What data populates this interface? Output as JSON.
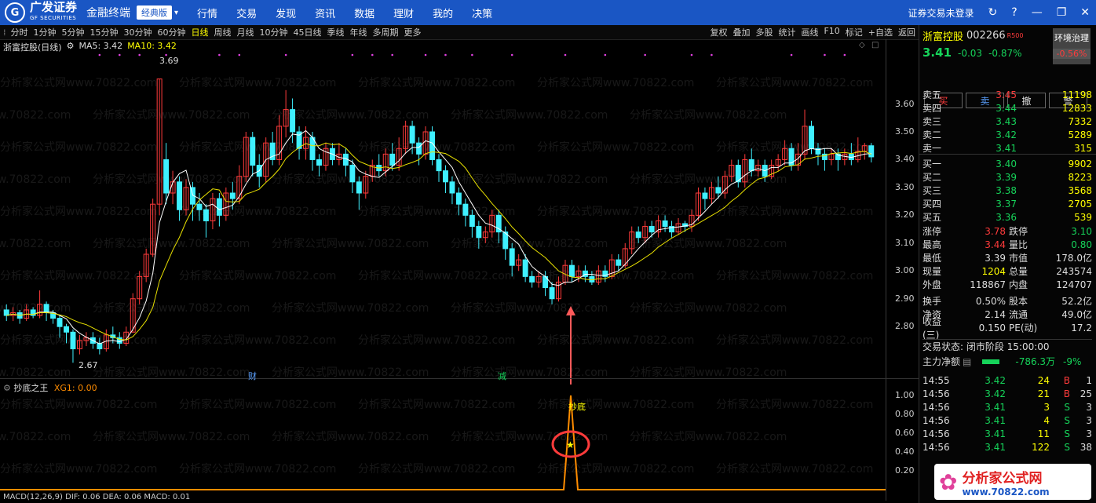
{
  "app": {
    "brand": "广发证券",
    "brand_sub": "GF SECURITIES",
    "app_name": "金融终端",
    "edition": "经典版",
    "menu": [
      "行情",
      "交易",
      "发现",
      "资讯",
      "数据",
      "理财",
      "我的",
      "决策"
    ],
    "login_status": "证券交易未登录"
  },
  "toolbar": {
    "periods": [
      "分时",
      "1分钟",
      "5分钟",
      "15分钟",
      "30分钟",
      "60分钟",
      "日线",
      "周线",
      "月线",
      "10分钟",
      "45日线",
      "季线",
      "年线",
      "多周期",
      "更多"
    ],
    "active_period": "日线",
    "right_tools": [
      "复权",
      "叠加",
      "多股",
      "统计",
      "画线",
      "F10",
      "标记",
      "+自选",
      "返回"
    ]
  },
  "chart_info": {
    "name": "浙富控股(日线)",
    "ma5": "MA5: 3.42",
    "ma10": "MA10: 3.42"
  },
  "price_axis": [
    "3.60",
    "3.50",
    "3.40",
    "3.30",
    "3.20",
    "3.10",
    "3.00",
    "2.90",
    "2.80"
  ],
  "annotations": {
    "high_label": "3.69",
    "low_label": "2.67",
    "cai": "财",
    "jian": "减",
    "chaodi": "抄底"
  },
  "indicator": {
    "name": "抄底之王",
    "xg": "XG1: 0.00",
    "axis": [
      "1.00",
      "0.80",
      "0.60",
      "0.40",
      "0.20"
    ],
    "macd_label": "MACD(12,26,9) DIF: 0.06 DEA: 0.06 MACD: 0.01"
  },
  "watermark": "分析家公式网www.70822.com",
  "stock": {
    "name": "浙富控股",
    "code": "002266",
    "tag": "R500",
    "env": "环境治理",
    "price": "3.41",
    "change": "-0.03",
    "change_pct": "-0.87%",
    "env_pct": "-0.56%",
    "buttons": [
      "买",
      "卖",
      "撤",
      "警"
    ]
  },
  "asks": [
    {
      "label": "卖五",
      "price": "3.45",
      "vol": "11198"
    },
    {
      "label": "卖四",
      "price": "3.44",
      "vol": "12833"
    },
    {
      "label": "卖三",
      "price": "3.43",
      "vol": "7332"
    },
    {
      "label": "卖二",
      "price": "3.42",
      "vol": "5289"
    },
    {
      "label": "卖一",
      "price": "3.41",
      "vol": "315"
    }
  ],
  "bids": [
    {
      "label": "买一",
      "price": "3.40",
      "vol": "9902"
    },
    {
      "label": "买二",
      "price": "3.39",
      "vol": "8223"
    },
    {
      "label": "买三",
      "price": "3.38",
      "vol": "3568"
    },
    {
      "label": "买四",
      "price": "3.37",
      "vol": "2705"
    },
    {
      "label": "买五",
      "price": "3.36",
      "vol": "539"
    }
  ],
  "stats": [
    {
      "l1": "涨停",
      "v1": "3.78",
      "l2": "跌停",
      "v2": "3.10"
    },
    {
      "l1": "最高",
      "v1": "3.44",
      "l2": "量比",
      "v2": "0.80"
    },
    {
      "l1": "最低",
      "v1": "3.39",
      "l2": "市值",
      "v2": "178.0亿"
    },
    {
      "l1": "现量",
      "v1": "1204",
      "l2": "总量",
      "v2": "243574"
    },
    {
      "l1": "外盘",
      "v1": "118867",
      "l2": "内盘",
      "v2": "124707"
    },
    {
      "l1": "换手",
      "v1": "0.50%",
      "l2": "股本",
      "v2": "52.2亿"
    },
    {
      "l1": "净资",
      "v1": "2.14",
      "l2": "流通",
      "v2": "49.0亿"
    },
    {
      "l1": "收益(三)",
      "v1": "0.150",
      "l2": "PE(动)",
      "v2": "17.2"
    }
  ],
  "trade_status": "交易状态: 闭市阶段 15:00:00",
  "main_net": {
    "label": "主力净额",
    "value": "-786.3万",
    "pct": "-9%"
  },
  "ticks": [
    {
      "time": "14:55",
      "price": "3.42",
      "vol": "24",
      "bs": "B",
      "n": "1"
    },
    {
      "time": "14:56",
      "price": "3.42",
      "vol": "21",
      "bs": "B",
      "n": "25"
    },
    {
      "time": "14:56",
      "price": "3.41",
      "vol": "3",
      "bs": "S",
      "n": "3"
    },
    {
      "time": "14:56",
      "price": "3.41",
      "vol": "4",
      "bs": "S",
      "n": "3"
    },
    {
      "time": "14:56",
      "price": "3.41",
      "vol": "11",
      "bs": "S",
      "n": "3"
    },
    {
      "time": "14:56",
      "price": "3.41",
      "vol": "122",
      "bs": "S",
      "n": "38"
    }
  ],
  "site_badge": {
    "name": "分析家公式网",
    "url": "www.70822.com"
  },
  "chart_data": {
    "type": "candlestick",
    "y_range": [
      2.62,
      3.72
    ],
    "candles": [
      [
        2.86,
        2.84,
        2.88,
        2.82
      ],
      [
        2.84,
        2.85,
        2.87,
        2.82
      ],
      [
        2.85,
        2.83,
        2.86,
        2.81
      ],
      [
        2.83,
        2.86,
        2.88,
        2.82
      ],
      [
        2.86,
        2.84,
        2.87,
        2.83
      ],
      [
        2.84,
        2.88,
        2.93,
        2.83
      ],
      [
        2.88,
        2.85,
        2.89,
        2.82
      ],
      [
        2.85,
        2.83,
        2.86,
        2.81
      ],
      [
        2.83,
        2.8,
        2.84,
        2.76
      ],
      [
        2.8,
        2.78,
        2.81,
        2.74
      ],
      [
        2.78,
        2.72,
        2.79,
        2.67
      ],
      [
        2.72,
        2.75,
        2.77,
        2.7
      ],
      [
        2.75,
        2.76,
        2.78,
        2.73
      ],
      [
        2.76,
        2.74,
        2.78,
        2.72
      ],
      [
        2.74,
        2.72,
        2.76,
        2.7
      ],
      [
        2.72,
        2.77,
        2.79,
        2.71
      ],
      [
        2.77,
        2.76,
        2.8,
        2.74
      ],
      [
        2.76,
        2.74,
        2.78,
        2.72
      ],
      [
        2.74,
        2.78,
        2.8,
        2.73
      ],
      [
        2.78,
        2.9,
        2.92,
        2.78
      ],
      [
        2.9,
        2.98,
        3.0,
        2.88
      ],
      [
        2.98,
        3.06,
        3.08,
        2.96
      ],
      [
        3.06,
        3.24,
        3.26,
        3.05
      ],
      [
        3.24,
        3.69,
        3.69,
        3.2
      ],
      [
        3.4,
        3.28,
        3.46,
        3.24
      ],
      [
        3.28,
        3.32,
        3.36,
        3.24
      ],
      [
        3.32,
        3.22,
        3.34,
        3.18
      ],
      [
        3.22,
        3.3,
        3.33,
        3.2
      ],
      [
        3.3,
        3.24,
        3.32,
        3.18
      ],
      [
        3.24,
        3.22,
        3.28,
        3.18
      ],
      [
        3.22,
        3.18,
        3.24,
        3.12
      ],
      [
        3.18,
        3.26,
        3.28,
        3.15
      ],
      [
        3.26,
        3.2,
        3.28,
        3.16
      ],
      [
        3.2,
        3.28,
        3.3,
        3.18
      ],
      [
        3.28,
        3.26,
        3.32,
        3.22
      ],
      [
        3.26,
        3.34,
        3.38,
        3.24
      ],
      [
        3.34,
        3.48,
        3.5,
        3.32
      ],
      [
        3.48,
        3.38,
        3.5,
        3.34
      ],
      [
        3.38,
        3.34,
        3.42,
        3.3
      ],
      [
        3.34,
        3.46,
        3.48,
        3.32
      ],
      [
        3.46,
        3.4,
        3.5,
        3.38
      ],
      [
        3.4,
        3.52,
        3.56,
        3.38
      ],
      [
        3.52,
        3.58,
        3.65,
        3.48
      ],
      [
        3.58,
        3.5,
        3.62,
        3.46
      ],
      [
        3.5,
        3.44,
        3.52,
        3.4
      ],
      [
        3.44,
        3.48,
        3.52,
        3.4
      ],
      [
        3.48,
        3.4,
        3.5,
        3.36
      ],
      [
        3.4,
        3.38,
        3.42,
        3.34
      ],
      [
        3.38,
        3.44,
        3.46,
        3.36
      ],
      [
        3.44,
        3.4,
        3.46,
        3.38
      ],
      [
        3.4,
        3.42,
        3.46,
        3.38
      ],
      [
        3.42,
        3.38,
        3.44,
        3.34
      ],
      [
        3.38,
        3.32,
        3.4,
        3.28
      ],
      [
        3.32,
        3.28,
        3.34,
        3.22
      ],
      [
        3.28,
        3.34,
        3.36,
        3.26
      ],
      [
        3.34,
        3.38,
        3.4,
        3.32
      ],
      [
        3.38,
        3.36,
        3.42,
        3.34
      ],
      [
        3.36,
        3.42,
        3.44,
        3.34
      ],
      [
        3.42,
        3.38,
        3.46,
        3.36
      ],
      [
        3.38,
        3.44,
        3.48,
        3.36
      ],
      [
        3.44,
        3.52,
        3.54,
        3.42
      ],
      [
        3.52,
        3.46,
        3.54,
        3.42
      ],
      [
        3.46,
        3.42,
        3.48,
        3.38
      ],
      [
        3.42,
        3.5,
        3.52,
        3.4
      ],
      [
        3.5,
        3.4,
        3.52,
        3.38
      ],
      [
        3.4,
        3.36,
        3.42,
        3.32
      ],
      [
        3.36,
        3.32,
        3.38,
        3.28
      ],
      [
        3.32,
        3.28,
        3.34,
        3.24
      ],
      [
        3.28,
        3.24,
        3.3,
        3.2
      ],
      [
        3.24,
        3.2,
        3.26,
        3.16
      ],
      [
        3.2,
        3.16,
        3.22,
        3.12
      ],
      [
        3.16,
        3.12,
        3.18,
        3.08
      ],
      [
        3.12,
        3.14,
        3.16,
        3.1
      ],
      [
        3.14,
        3.2,
        3.22,
        3.12
      ],
      [
        3.2,
        3.14,
        3.22,
        3.1
      ],
      [
        3.14,
        3.08,
        3.16,
        3.04
      ],
      [
        3.08,
        3.02,
        3.1,
        2.98
      ],
      [
        3.02,
        3.04,
        3.06,
        3.0
      ],
      [
        3.04,
        2.98,
        3.06,
        2.96
      ],
      [
        2.98,
        2.96,
        3.0,
        2.94
      ],
      [
        2.96,
        2.98,
        3.0,
        2.94
      ],
      [
        2.98,
        2.94,
        3.0,
        2.91
      ],
      [
        2.94,
        2.9,
        2.96,
        2.88
      ],
      [
        2.9,
        2.96,
        2.98,
        2.89
      ],
      [
        2.96,
        3.02,
        3.04,
        2.95
      ],
      [
        3.02,
        2.98,
        3.04,
        2.96
      ],
      [
        2.98,
        3.0,
        3.02,
        2.96
      ],
      [
        3.0,
        2.98,
        3.02,
        2.96
      ],
      [
        2.98,
        2.96,
        3.0,
        2.95
      ],
      [
        2.96,
        3.0,
        3.02,
        2.95
      ],
      [
        3.0,
        2.98,
        3.02,
        2.96
      ],
      [
        2.98,
        3.04,
        3.06,
        2.97
      ],
      [
        3.04,
        3.02,
        3.06,
        3.0
      ],
      [
        3.02,
        3.08,
        3.1,
        3.01
      ],
      [
        3.08,
        3.14,
        3.16,
        3.06
      ],
      [
        3.14,
        3.12,
        3.16,
        3.1
      ],
      [
        3.12,
        3.16,
        3.18,
        3.1
      ],
      [
        3.16,
        3.14,
        3.18,
        3.12
      ],
      [
        3.14,
        3.18,
        3.2,
        3.12
      ],
      [
        3.18,
        3.16,
        3.2,
        3.14
      ],
      [
        3.16,
        3.14,
        3.18,
        3.12
      ],
      [
        3.14,
        3.17,
        3.19,
        3.13
      ],
      [
        3.17,
        3.16,
        3.18,
        3.14
      ],
      [
        3.16,
        3.2,
        3.22,
        3.14
      ],
      [
        3.2,
        3.28,
        3.3,
        3.18
      ],
      [
        3.28,
        3.26,
        3.3,
        3.22
      ],
      [
        3.26,
        3.3,
        3.32,
        3.24
      ],
      [
        3.3,
        3.28,
        3.34,
        3.26
      ],
      [
        3.28,
        3.34,
        3.36,
        3.26
      ],
      [
        3.34,
        3.38,
        3.4,
        3.32
      ],
      [
        3.38,
        3.32,
        3.4,
        3.3
      ],
      [
        3.32,
        3.4,
        3.42,
        3.3
      ],
      [
        3.4,
        3.36,
        3.44,
        3.34
      ],
      [
        3.36,
        3.38,
        3.4,
        3.34
      ],
      [
        3.38,
        3.34,
        3.4,
        3.32
      ],
      [
        3.34,
        3.38,
        3.4,
        3.33
      ],
      [
        3.38,
        3.4,
        3.42,
        3.36
      ],
      [
        3.4,
        3.44,
        3.47,
        3.38
      ],
      [
        3.44,
        3.38,
        3.46,
        3.36
      ],
      [
        3.38,
        3.42,
        3.46,
        3.36
      ],
      [
        3.42,
        3.52,
        3.58,
        3.4
      ],
      [
        3.52,
        3.44,
        3.54,
        3.42
      ],
      [
        3.44,
        3.42,
        3.46,
        3.38
      ],
      [
        3.42,
        3.4,
        3.44,
        3.36
      ],
      [
        3.4,
        3.42,
        3.44,
        3.38
      ],
      [
        3.42,
        3.4,
        3.44,
        3.36
      ],
      [
        3.4,
        3.42,
        3.44,
        3.38
      ],
      [
        3.42,
        3.4,
        3.46,
        3.38
      ],
      [
        3.4,
        3.43,
        3.48,
        3.39
      ],
      [
        3.43,
        3.45,
        3.46,
        3.4
      ],
      [
        3.45,
        3.41,
        3.46,
        3.39
      ]
    ]
  }
}
